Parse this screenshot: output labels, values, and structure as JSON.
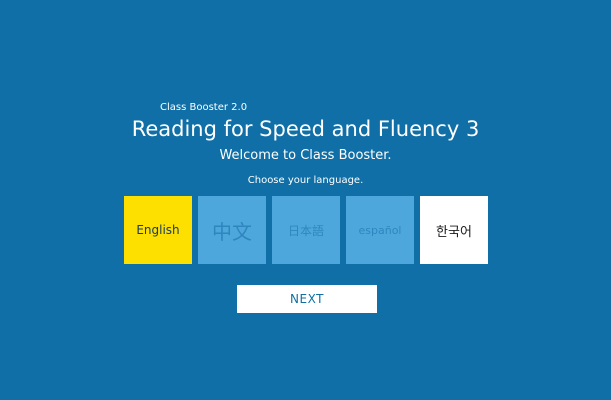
{
  "header": {
    "app_name": "Class Booster 2.0",
    "title": "Reading for Speed and Fluency 3",
    "welcome": "Welcome to Class Booster."
  },
  "language_picker": {
    "prompt": "Choose your language.",
    "options": [
      {
        "label": "English",
        "state": "selected"
      },
      {
        "label": "中文",
        "state": "unavailable"
      },
      {
        "label": "日本語",
        "state": "unavailable"
      },
      {
        "label": "español",
        "state": "unavailable"
      },
      {
        "label": "한국어",
        "state": "available"
      }
    ]
  },
  "footer": {
    "next_label": "NEXT"
  },
  "colors": {
    "background": "#0f6fa6",
    "selected_tile": "#fde000",
    "unavailable_tile": "#4ea7dc",
    "available_tile": "#ffffff"
  }
}
